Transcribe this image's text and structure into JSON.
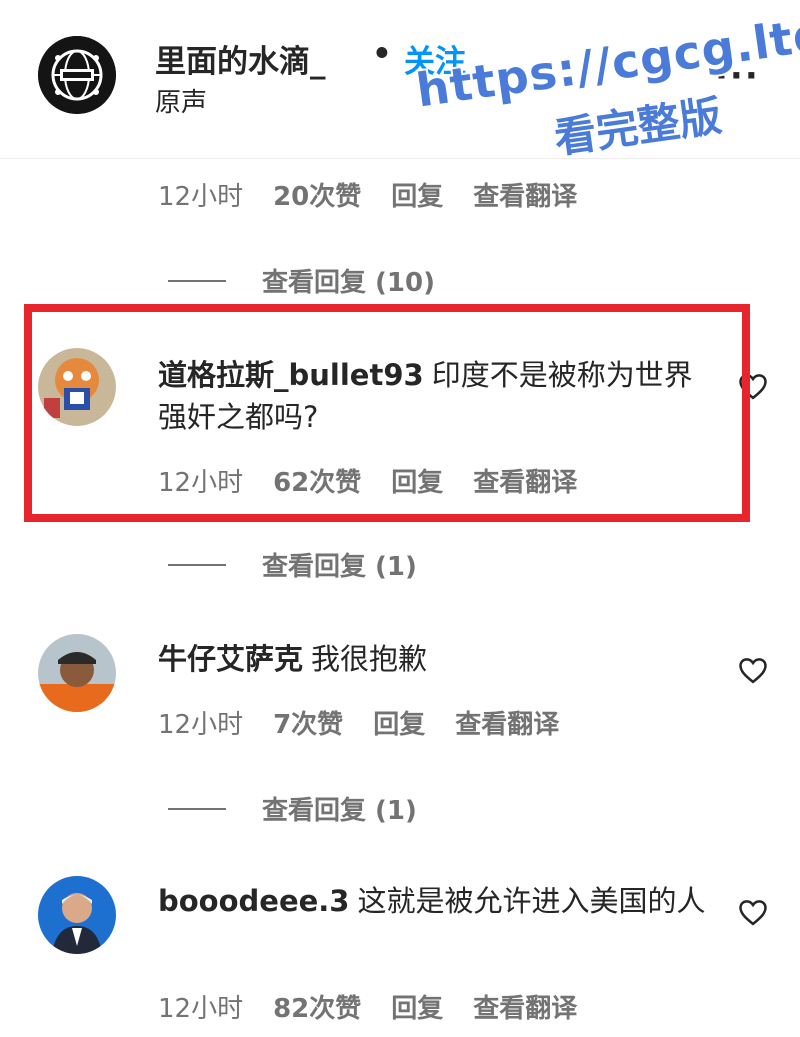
{
  "header": {
    "username": "里面的水滴_",
    "separator": "•",
    "follow_label": "关注",
    "subtitle": "原声",
    "more_label": "···"
  },
  "watermark": {
    "line1": "https://cgcg.ltd",
    "line2": "看完整版"
  },
  "comments": [
    {
      "username": "",
      "text": "",
      "time": "12小时",
      "likes": "20次赞",
      "reply_label": "回复",
      "translate_label": "查看翻译",
      "view_replies": "查看回复 (10)"
    },
    {
      "username": "道格拉斯_bullet93",
      "text": "印度不是被称为世界强奸之都吗?",
      "time": "12小时",
      "likes": "62次赞",
      "reply_label": "回复",
      "translate_label": "查看翻译",
      "view_replies": "查看回复 (1)"
    },
    {
      "username": "牛仔艾萨克",
      "text": "我很抱歉",
      "time": "12小时",
      "likes": "7次赞",
      "reply_label": "回复",
      "translate_label": "查看翻译",
      "view_replies": "查看回复 (1)"
    },
    {
      "username": "booodeee.3",
      "text": "这就是被允许进入美国的人",
      "time": "12小时",
      "likes": "82次赞",
      "reply_label": "回复",
      "translate_label": "查看翻译"
    }
  ],
  "colors": {
    "follow": "#0095f6",
    "highlight": "#e8242c",
    "watermark": "#4a7bd8",
    "meta": "#737373"
  }
}
